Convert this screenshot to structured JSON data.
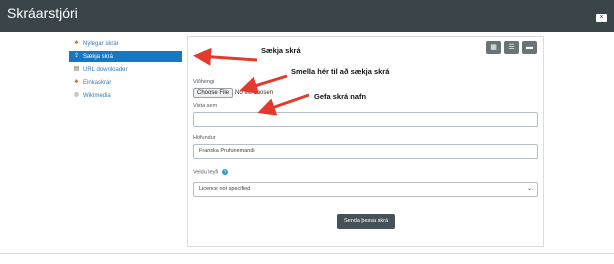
{
  "window": {
    "title": "Skráarstjóri",
    "close_label": "×"
  },
  "sidebar": {
    "items": [
      {
        "label": "Nýlegar skrár",
        "icon": "tree-icon",
        "active": false
      },
      {
        "label": "Sækja skrá",
        "icon": "upload-icon",
        "active": true
      },
      {
        "label": "URL downloader",
        "icon": "url-icon",
        "active": false
      },
      {
        "label": "Einkaskrár",
        "icon": "private-files-icon",
        "active": false
      },
      {
        "label": "Wikimedia",
        "icon": "wikimedia-icon",
        "active": false
      }
    ]
  },
  "toolbar": {
    "icons": [
      "grid-view-icon",
      "list-view-icon",
      "folder-view-icon"
    ]
  },
  "form": {
    "attachment_label": "Viðhengi",
    "choose_file_label": "Choose File",
    "no_file_text": "No file chosen",
    "save_as_label": "Vista sem",
    "save_as_value": "",
    "author_label": "Höfundur",
    "author_value": "Franska Prufunemandi",
    "license_label": "Veldu leyfi",
    "license_value": "Licence not specified",
    "submit_label": "Senda þessa skrá"
  },
  "annotations": {
    "upload": "Sækja skrá",
    "click": "Smella hér til að sækja skrá",
    "name": "Gefa skrá nafn",
    "arrow_color": "#e23a2c"
  },
  "colors": {
    "titlebar": "#3a4549",
    "active": "#1678c2",
    "link": "#3a79b8",
    "button": "#475258"
  }
}
